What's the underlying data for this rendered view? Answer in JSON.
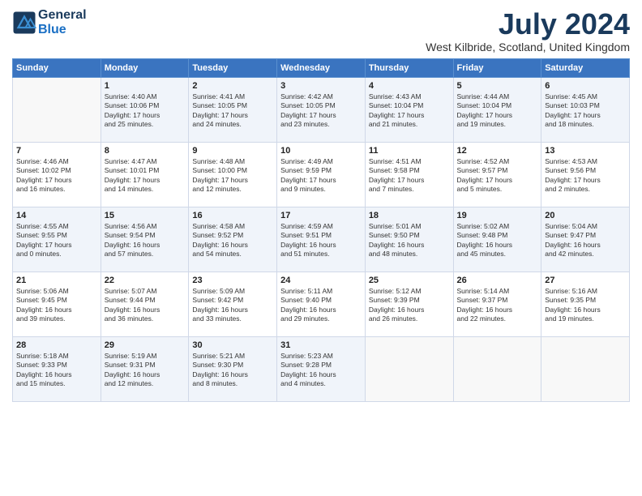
{
  "header": {
    "logo_line1": "General",
    "logo_line2": "Blue",
    "month": "July 2024",
    "location": "West Kilbride, Scotland, United Kingdom"
  },
  "weekdays": [
    "Sunday",
    "Monday",
    "Tuesday",
    "Wednesday",
    "Thursday",
    "Friday",
    "Saturday"
  ],
  "weeks": [
    [
      {
        "day": "",
        "info": ""
      },
      {
        "day": "1",
        "info": "Sunrise: 4:40 AM\nSunset: 10:06 PM\nDaylight: 17 hours\nand 25 minutes."
      },
      {
        "day": "2",
        "info": "Sunrise: 4:41 AM\nSunset: 10:05 PM\nDaylight: 17 hours\nand 24 minutes."
      },
      {
        "day": "3",
        "info": "Sunrise: 4:42 AM\nSunset: 10:05 PM\nDaylight: 17 hours\nand 23 minutes."
      },
      {
        "day": "4",
        "info": "Sunrise: 4:43 AM\nSunset: 10:04 PM\nDaylight: 17 hours\nand 21 minutes."
      },
      {
        "day": "5",
        "info": "Sunrise: 4:44 AM\nSunset: 10:04 PM\nDaylight: 17 hours\nand 19 minutes."
      },
      {
        "day": "6",
        "info": "Sunrise: 4:45 AM\nSunset: 10:03 PM\nDaylight: 17 hours\nand 18 minutes."
      }
    ],
    [
      {
        "day": "7",
        "info": "Sunrise: 4:46 AM\nSunset: 10:02 PM\nDaylight: 17 hours\nand 16 minutes."
      },
      {
        "day": "8",
        "info": "Sunrise: 4:47 AM\nSunset: 10:01 PM\nDaylight: 17 hours\nand 14 minutes."
      },
      {
        "day": "9",
        "info": "Sunrise: 4:48 AM\nSunset: 10:00 PM\nDaylight: 17 hours\nand 12 minutes."
      },
      {
        "day": "10",
        "info": "Sunrise: 4:49 AM\nSunset: 9:59 PM\nDaylight: 17 hours\nand 9 minutes."
      },
      {
        "day": "11",
        "info": "Sunrise: 4:51 AM\nSunset: 9:58 PM\nDaylight: 17 hours\nand 7 minutes."
      },
      {
        "day": "12",
        "info": "Sunrise: 4:52 AM\nSunset: 9:57 PM\nDaylight: 17 hours\nand 5 minutes."
      },
      {
        "day": "13",
        "info": "Sunrise: 4:53 AM\nSunset: 9:56 PM\nDaylight: 17 hours\nand 2 minutes."
      }
    ],
    [
      {
        "day": "14",
        "info": "Sunrise: 4:55 AM\nSunset: 9:55 PM\nDaylight: 17 hours\nand 0 minutes."
      },
      {
        "day": "15",
        "info": "Sunrise: 4:56 AM\nSunset: 9:54 PM\nDaylight: 16 hours\nand 57 minutes."
      },
      {
        "day": "16",
        "info": "Sunrise: 4:58 AM\nSunset: 9:52 PM\nDaylight: 16 hours\nand 54 minutes."
      },
      {
        "day": "17",
        "info": "Sunrise: 4:59 AM\nSunset: 9:51 PM\nDaylight: 16 hours\nand 51 minutes."
      },
      {
        "day": "18",
        "info": "Sunrise: 5:01 AM\nSunset: 9:50 PM\nDaylight: 16 hours\nand 48 minutes."
      },
      {
        "day": "19",
        "info": "Sunrise: 5:02 AM\nSunset: 9:48 PM\nDaylight: 16 hours\nand 45 minutes."
      },
      {
        "day": "20",
        "info": "Sunrise: 5:04 AM\nSunset: 9:47 PM\nDaylight: 16 hours\nand 42 minutes."
      }
    ],
    [
      {
        "day": "21",
        "info": "Sunrise: 5:06 AM\nSunset: 9:45 PM\nDaylight: 16 hours\nand 39 minutes."
      },
      {
        "day": "22",
        "info": "Sunrise: 5:07 AM\nSunset: 9:44 PM\nDaylight: 16 hours\nand 36 minutes."
      },
      {
        "day": "23",
        "info": "Sunrise: 5:09 AM\nSunset: 9:42 PM\nDaylight: 16 hours\nand 33 minutes."
      },
      {
        "day": "24",
        "info": "Sunrise: 5:11 AM\nSunset: 9:40 PM\nDaylight: 16 hours\nand 29 minutes."
      },
      {
        "day": "25",
        "info": "Sunrise: 5:12 AM\nSunset: 9:39 PM\nDaylight: 16 hours\nand 26 minutes."
      },
      {
        "day": "26",
        "info": "Sunrise: 5:14 AM\nSunset: 9:37 PM\nDaylight: 16 hours\nand 22 minutes."
      },
      {
        "day": "27",
        "info": "Sunrise: 5:16 AM\nSunset: 9:35 PM\nDaylight: 16 hours\nand 19 minutes."
      }
    ],
    [
      {
        "day": "28",
        "info": "Sunrise: 5:18 AM\nSunset: 9:33 PM\nDaylight: 16 hours\nand 15 minutes."
      },
      {
        "day": "29",
        "info": "Sunrise: 5:19 AM\nSunset: 9:31 PM\nDaylight: 16 hours\nand 12 minutes."
      },
      {
        "day": "30",
        "info": "Sunrise: 5:21 AM\nSunset: 9:30 PM\nDaylight: 16 hours\nand 8 minutes."
      },
      {
        "day": "31",
        "info": "Sunrise: 5:23 AM\nSunset: 9:28 PM\nDaylight: 16 hours\nand 4 minutes."
      },
      {
        "day": "",
        "info": ""
      },
      {
        "day": "",
        "info": ""
      },
      {
        "day": "",
        "info": ""
      }
    ]
  ]
}
